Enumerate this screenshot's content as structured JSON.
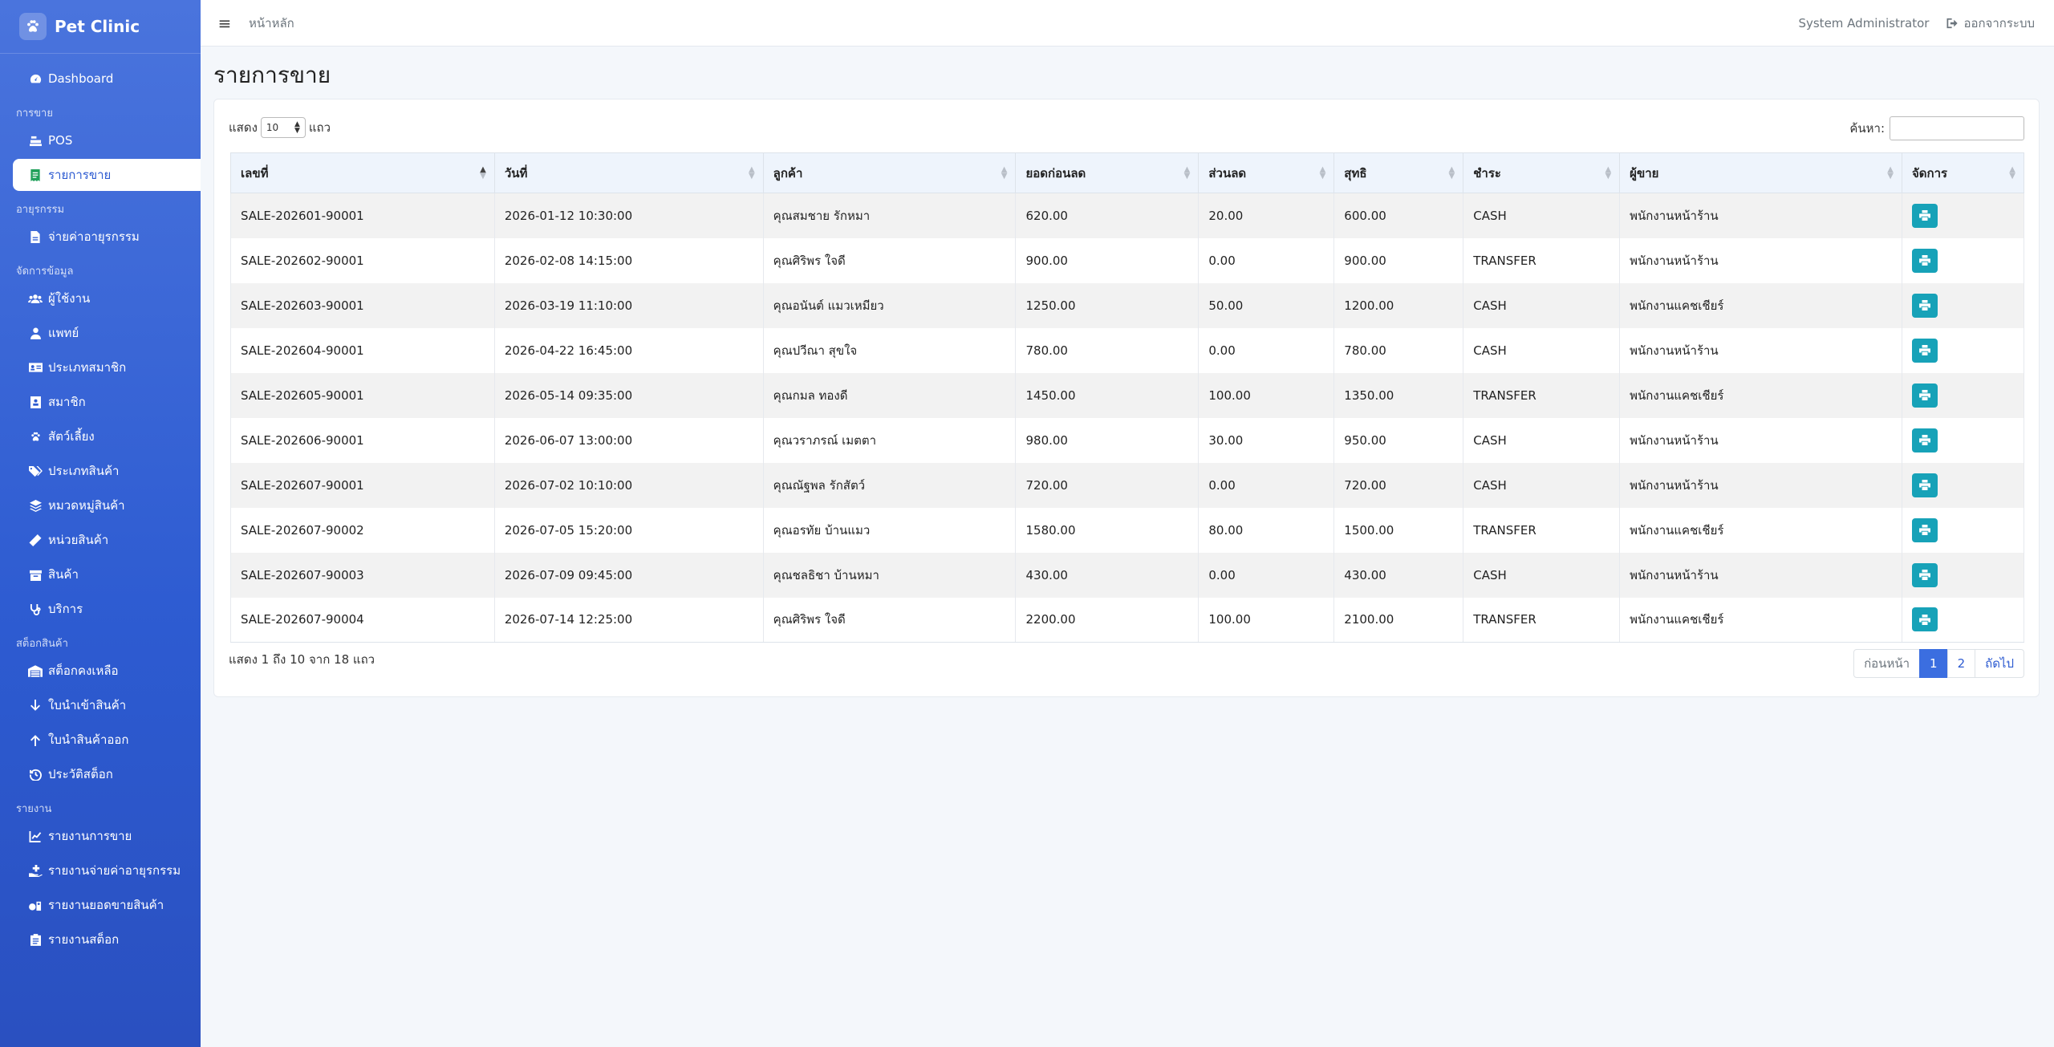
{
  "app": {
    "title": "Pet Clinic"
  },
  "topbar": {
    "breadcrumb": "หน้าหลัก",
    "user": "System Administrator",
    "logout": "ออกจากระบบ"
  },
  "sidebar": {
    "dashboard": "Dashboard",
    "sections": {
      "sales": "การขาย",
      "medical": "อายุรกรรม",
      "data": "จัดการข้อมูล",
      "stock": "สต็อกสินค้า",
      "reports": "รายงาน"
    },
    "items": {
      "pos": "POS",
      "sales_list": "รายการขาย",
      "medical_pay": "จ่ายค่าอายุรกรรม",
      "users": "ผู้ใช้งาน",
      "doctors": "แพทย์",
      "member_types": "ประเภทสมาชิก",
      "members": "สมาชิก",
      "pets": "สัตว์เลี้ยง",
      "product_types": "ประเภทสินค้า",
      "product_categories": "หมวดหมู่สินค้า",
      "product_units": "หน่วยสินค้า",
      "products": "สินค้า",
      "services": "บริการ",
      "stock_balance": "สต็อกคงเหลือ",
      "stock_in": "ใบนำเข้าสินค้า",
      "stock_out": "ใบนำสินค้าออก",
      "stock_history": "ประวัติสต็อก",
      "report_sales": "รายงานการขาย",
      "report_medical": "รายงานจ่ายค่าอายุรกรรม",
      "report_product_sales": "รายงานยอดขายสินค้า",
      "report_stock": "รายงานสต็อก"
    }
  },
  "page": {
    "title": "รายการขาย"
  },
  "controls": {
    "show_label": "แสดง",
    "length_value": "10",
    "rows_label": "แถว",
    "search_label": "ค้นหา:",
    "search_value": ""
  },
  "table": {
    "headers": [
      "เลขที่",
      "วันที่",
      "ลูกค้า",
      "ยอดก่อนลด",
      "ส่วนลด",
      "สุทธิ",
      "ชำระ",
      "ผู้ขาย",
      "จัดการ"
    ],
    "rows": [
      [
        "SALE-202601-90001",
        "2026-01-12 10:30:00",
        "คุณสมชาย รักหมา",
        "620.00",
        "20.00",
        "600.00",
        "CASH",
        "พนักงานหน้าร้าน"
      ],
      [
        "SALE-202602-90001",
        "2026-02-08 14:15:00",
        "คุณศิริพร ใจดี",
        "900.00",
        "0.00",
        "900.00",
        "TRANSFER",
        "พนักงานหน้าร้าน"
      ],
      [
        "SALE-202603-90001",
        "2026-03-19 11:10:00",
        "คุณอนันต์ แมวเหมียว",
        "1250.00",
        "50.00",
        "1200.00",
        "CASH",
        "พนักงานแคชเชียร์"
      ],
      [
        "SALE-202604-90001",
        "2026-04-22 16:45:00",
        "คุณปวีณา สุขใจ",
        "780.00",
        "0.00",
        "780.00",
        "CASH",
        "พนักงานหน้าร้าน"
      ],
      [
        "SALE-202605-90001",
        "2026-05-14 09:35:00",
        "คุณกมล ทองดี",
        "1450.00",
        "100.00",
        "1350.00",
        "TRANSFER",
        "พนักงานแคชเชียร์"
      ],
      [
        "SALE-202606-90001",
        "2026-06-07 13:00:00",
        "คุณวราภรณ์ เมตตา",
        "980.00",
        "30.00",
        "950.00",
        "CASH",
        "พนักงานหน้าร้าน"
      ],
      [
        "SALE-202607-90001",
        "2026-07-02 10:10:00",
        "คุณณัฐพล รักสัตว์",
        "720.00",
        "0.00",
        "720.00",
        "CASH",
        "พนักงานหน้าร้าน"
      ],
      [
        "SALE-202607-90002",
        "2026-07-05 15:20:00",
        "คุณอรทัย บ้านแมว",
        "1580.00",
        "80.00",
        "1500.00",
        "TRANSFER",
        "พนักงานแคชเชียร์"
      ],
      [
        "SALE-202607-90003",
        "2026-07-09 09:45:00",
        "คุณชลธิชา บ้านหมา",
        "430.00",
        "0.00",
        "430.00",
        "CASH",
        "พนักงานหน้าร้าน"
      ],
      [
        "SALE-202607-90004",
        "2026-07-14 12:25:00",
        "คุณศิริพร ใจดี",
        "2200.00",
        "100.00",
        "2100.00",
        "TRANSFER",
        "พนักงานแคชเชียร์"
      ]
    ]
  },
  "footer": {
    "info": "แสดง 1 ถึง 10 จาก 18 แถว",
    "prev": "ก่อนหน้า",
    "page1": "1",
    "page2": "2",
    "next": "ถัดไป"
  },
  "colors": {
    "sidebar": "#2d5bd1",
    "accent": "#3b6ee0",
    "print_button": "#17a2b8",
    "active_icon": "#20a05a"
  }
}
